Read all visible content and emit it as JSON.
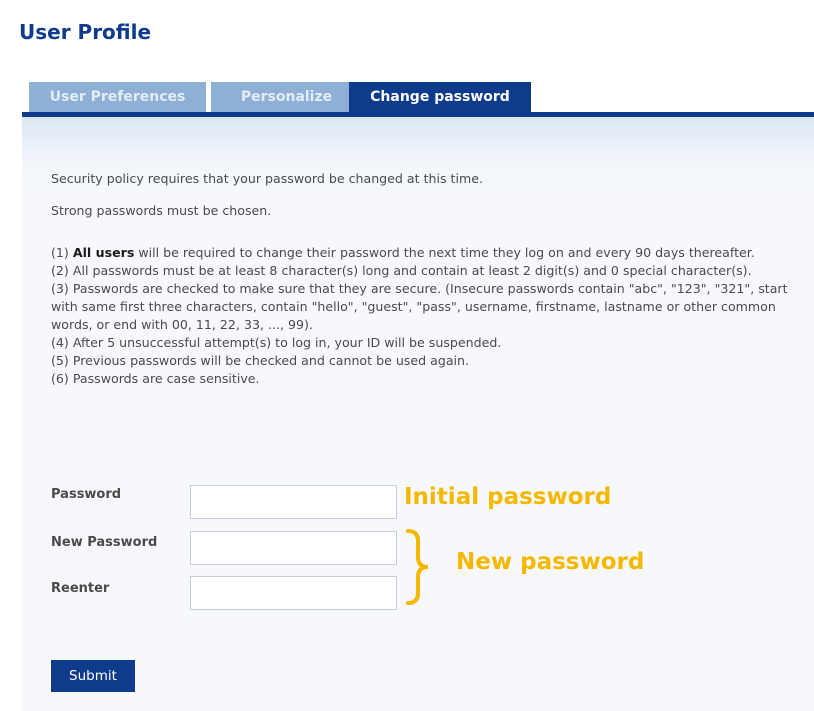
{
  "page_title": "User Profile",
  "tabs": [
    {
      "label": "User Preferences",
      "active": false
    },
    {
      "label": "Personalize",
      "active": false
    },
    {
      "label": "Change password",
      "active": true
    }
  ],
  "policy": {
    "intro": "Security policy requires that your password be changed at this time.",
    "strong_note": "Strong passwords must be chosen.",
    "rule1_prefix": "(1) ",
    "rule1_bold": "All users",
    "rule1_rest": " will be required to change their password the next time they log on and every 90 days thereafter.",
    "rule2": "(2) All passwords must be at least 8 character(s) long and contain at least 2 digit(s) and 0 special character(s).",
    "rule3": "(3) Passwords are checked to make sure that they are secure. (Insecure passwords contain \"abc\", \"123\", \"321\", start with same first three characters, contain \"hello\", \"guest\", \"pass\", username, firstname, lastname or other common words, or end with 00, 11, 22, 33, ..., 99).",
    "rule4": "(4) After 5 unsuccessful attempt(s) to log in, your ID will be suspended.",
    "rule5": "(5) Previous passwords will be checked and cannot be used again.",
    "rule6": "(6) Passwords are case sensitive."
  },
  "form": {
    "password_label": "Password",
    "password_value": "",
    "new_password_label": "New Password",
    "new_password_value": "",
    "reenter_label": "Reenter",
    "reenter_value": ""
  },
  "annotations": {
    "initial_password": "Initial password",
    "new_password": "New password",
    "color": "#f5b800"
  },
  "submit_label": "Submit",
  "colors": {
    "brand_blue": "#0e3b8c",
    "inactive_tab": "#8fb0d6"
  }
}
